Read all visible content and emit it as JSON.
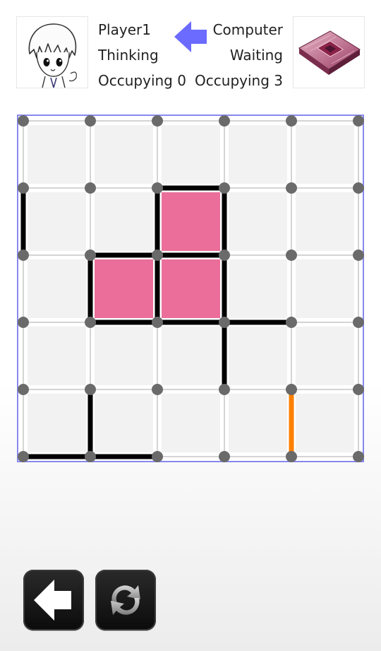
{
  "player": {
    "name": "Player1",
    "status": "Thinking",
    "score_text": "Occupying 0",
    "avatar_icon": "anime-character-avatar-icon"
  },
  "computer": {
    "name": "Computer",
    "status": "Waiting",
    "score_text": "Occupying 3",
    "avatar_icon": "cpu-chip-avatar-icon"
  },
  "turn_indicator": {
    "icon": "arrow-left-icon",
    "points_to": "player",
    "color": "#6b6bff"
  },
  "board": {
    "rows": 5,
    "cols": 5,
    "border_color": "#8888ee",
    "cell_color": "#f2f2f2",
    "dot_color": "#6a6a6a",
    "drawn_line_color": "#000000",
    "last_move_color": "#ff7f00",
    "claimed_color": "#ea6e99",
    "drawn_edges": [
      {
        "type": "h",
        "r": 1,
        "c": 2
      },
      {
        "type": "h",
        "r": 2,
        "c": 1
      },
      {
        "type": "h",
        "r": 2,
        "c": 2
      },
      {
        "type": "h",
        "r": 3,
        "c": 1
      },
      {
        "type": "h",
        "r": 3,
        "c": 2
      },
      {
        "type": "h",
        "r": 3,
        "c": 3
      },
      {
        "type": "h",
        "r": 5,
        "c": 0
      },
      {
        "type": "h",
        "r": 5,
        "c": 1
      },
      {
        "type": "v",
        "r": 1,
        "c": 0
      },
      {
        "type": "v",
        "r": 1,
        "c": 2
      },
      {
        "type": "v",
        "r": 1,
        "c": 3
      },
      {
        "type": "v",
        "r": 2,
        "c": 1
      },
      {
        "type": "v",
        "r": 2,
        "c": 2
      },
      {
        "type": "v",
        "r": 2,
        "c": 3
      },
      {
        "type": "v",
        "r": 3,
        "c": 3
      },
      {
        "type": "v",
        "r": 4,
        "c": 1
      }
    ],
    "last_move": {
      "type": "v",
      "r": 4,
      "c": 4
    },
    "claimed_boxes": [
      {
        "r": 1,
        "c": 2,
        "owner": "computer"
      },
      {
        "r": 2,
        "c": 1,
        "owner": "computer"
      },
      {
        "r": 2,
        "c": 2,
        "owner": "computer"
      }
    ]
  },
  "controls": {
    "back_icon": "arrow-left-icon",
    "restart_icon": "refresh-arrows-icon"
  }
}
